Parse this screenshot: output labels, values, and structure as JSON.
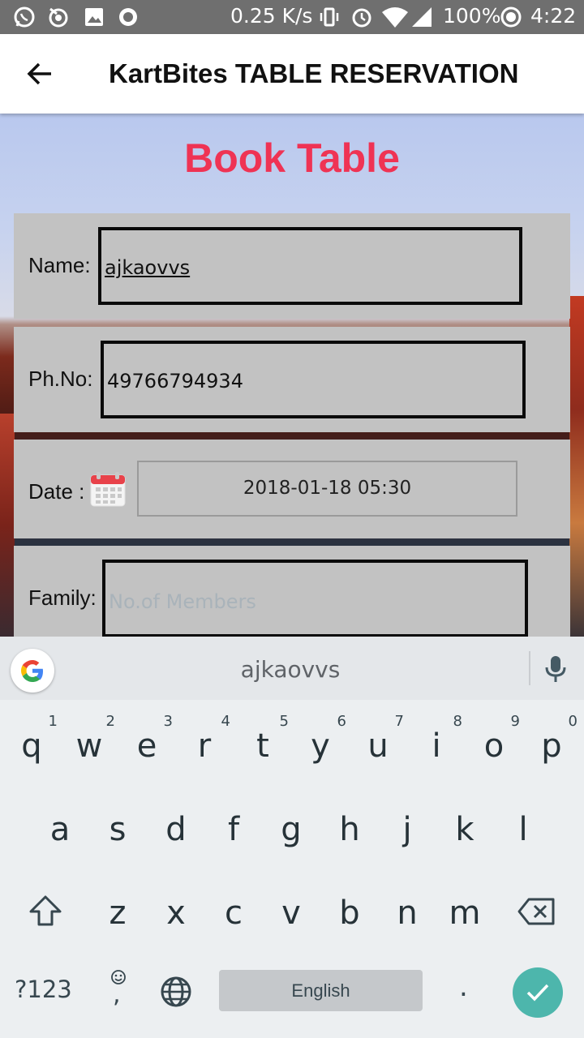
{
  "status_bar": {
    "speed": "0.25 K/s",
    "battery": "100%",
    "time": "4:22",
    "icons": [
      "whatsapp-icon",
      "app-notification-icon",
      "image-icon",
      "record-icon",
      "vibrate-icon",
      "alarm-icon",
      "wifi-icon",
      "signal-icon",
      "battery-circle-icon"
    ]
  },
  "app_bar": {
    "title": "KartBites TABLE RESERVATION",
    "back_icon": "back-arrow-icon"
  },
  "form": {
    "heading": "Book Table",
    "name_label": "Name:",
    "name_value": "ajkaovvs",
    "phone_label": "Ph.No:",
    "phone_value": "49766794934",
    "date_label": "Date :",
    "date_icon": "calendar-icon",
    "date_value": "2018-01-18 05:30",
    "family_label": "Family:",
    "family_placeholder": "No.of Members"
  },
  "keyboard": {
    "suggestion": "ajkaovvs",
    "row1": [
      {
        "key": "q",
        "num": "1"
      },
      {
        "key": "w",
        "num": "2"
      },
      {
        "key": "e",
        "num": "3"
      },
      {
        "key": "r",
        "num": "4"
      },
      {
        "key": "t",
        "num": "5"
      },
      {
        "key": "y",
        "num": "6"
      },
      {
        "key": "u",
        "num": "7"
      },
      {
        "key": "i",
        "num": "8"
      },
      {
        "key": "o",
        "num": "9"
      },
      {
        "key": "p",
        "num": "0"
      }
    ],
    "row2": [
      "a",
      "s",
      "d",
      "f",
      "g",
      "h",
      "j",
      "k",
      "l"
    ],
    "row3": [
      "z",
      "x",
      "c",
      "v",
      "b",
      "n",
      "m"
    ],
    "symbols_label": "?123",
    "comma": ",",
    "period": ".",
    "space_label": "English"
  },
  "colors": {
    "heading": "#ef3354",
    "form_row": "#c2c2c2",
    "enter_key": "#4db6ac"
  }
}
